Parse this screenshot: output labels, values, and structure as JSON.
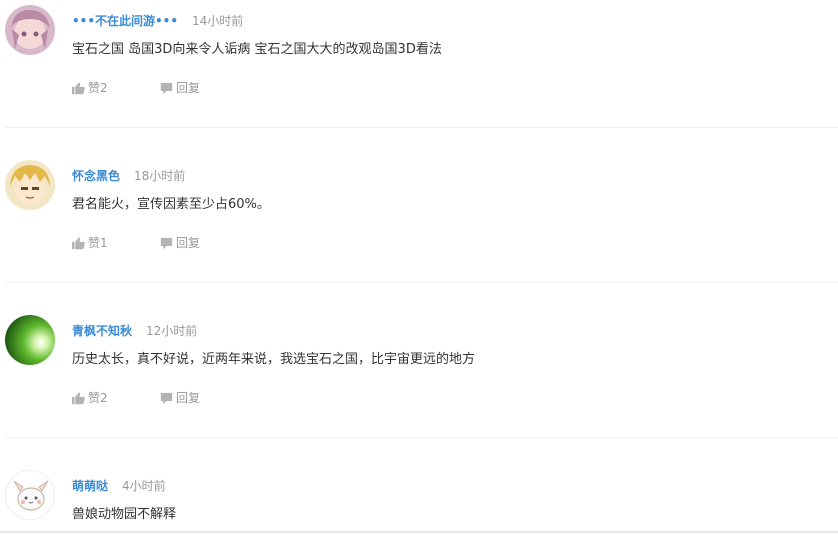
{
  "comments": [
    {
      "username": "•••不在此间游•••",
      "time": "14小时前",
      "text": "宝石之国 岛国3D向来令人诟病 宝石之国大大的改观岛国3D看法",
      "like_label": "赞2",
      "reply_label": "回复"
    },
    {
      "username": "怀念黑色",
      "time": "18小时前",
      "text": "君名能火，宣传因素至少占60%。",
      "like_label": "赞1",
      "reply_label": "回复"
    },
    {
      "username": "青枫不知秋",
      "time": "12小时前",
      "text": "历史太长，真不好说，近两年来说，我选宝石之国，比宇宙更远的地方",
      "like_label": "赞2",
      "reply_label": "回复"
    },
    {
      "username": "萌萌哒",
      "time": "4小时前",
      "text": "兽娘动物园不解释"
    }
  ],
  "icons": {
    "like": "thumbs-up-icon",
    "reply": "speech-bubble-icon"
  },
  "colors": {
    "username": "#3c8bd6",
    "muted": "#999999",
    "text": "#333333",
    "divider": "#eeeeee"
  }
}
